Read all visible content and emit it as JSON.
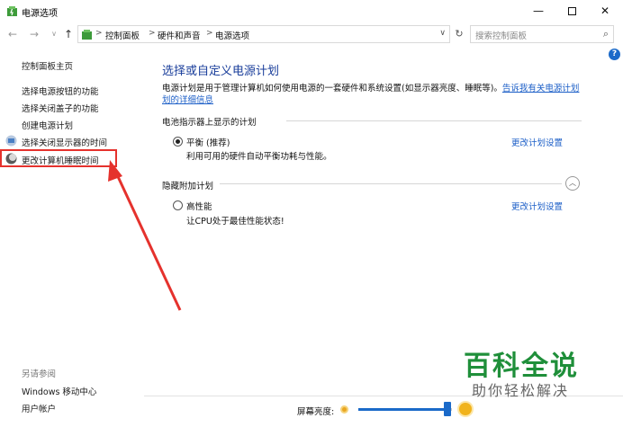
{
  "window": {
    "title": "电源选项",
    "minimize": "—",
    "close": "✕"
  },
  "address": {
    "breadcrumbs": [
      "控制面板",
      "硬件和声音",
      "电源选项"
    ],
    "separator": ">",
    "search_placeholder": "搜索控制面板"
  },
  "sidebar": {
    "home": "控制面板主页",
    "items": [
      {
        "label": "选择电源按钮的功能"
      },
      {
        "label": "选择关闭盖子的功能"
      },
      {
        "label": "创建电源计划"
      },
      {
        "label": "选择关闭显示器的时间"
      },
      {
        "label": "更改计算机睡眠时间"
      }
    ],
    "see_also_title": "另请参阅",
    "see_also": [
      "Windows 移动中心",
      "用户帐户"
    ]
  },
  "main": {
    "title": "选择或自定义电源计划",
    "description": "电源计划是用于管理计算机如何使用电源的一套硬件和系统设置(如显示器亮度、睡眠等)。",
    "description_link_1": "告诉我有关电源计划",
    "description_link_2": "划的详细信息",
    "battery_section": "电池指示器上显示的计划",
    "hidden_section": "隐藏附加计划",
    "plans": [
      {
        "name": "平衡 (推荐)",
        "desc": "利用可用的硬件自动平衡功耗与性能。",
        "link": "更改计划设置",
        "selected": true
      },
      {
        "name": "高性能",
        "desc": "让CPU处于最佳性能状态!",
        "link": "更改计划设置",
        "selected": false
      }
    ]
  },
  "brightness": {
    "label": "屏幕亮度:",
    "level_fraction": 0.95
  },
  "help": "?",
  "watermark": {
    "title": "百科全说",
    "subtitle": "助你轻松解决"
  },
  "colors": {
    "link": "#1b5ec7",
    "title": "#1a3e9b",
    "highlight_box": "#e5322d",
    "accent": "#1b6ac9",
    "watermark": "#1f8f3a"
  },
  "icons": [
    "power-options-icon",
    "back-arrow-icon",
    "forward-arrow-icon",
    "up-arrow-icon",
    "refresh-icon",
    "search-icon",
    "help-icon",
    "shield-display-icon",
    "moon-sleep-icon",
    "sun-dim-icon",
    "sun-bright-icon",
    "chevron-up-icon"
  ]
}
